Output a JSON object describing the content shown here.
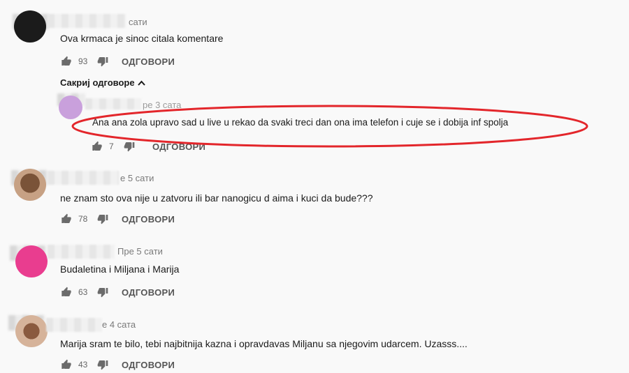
{
  "hide_replies": {
    "label": "Сакриј одговоре",
    "icon": "chevron-up-icon"
  },
  "reply_label": "ОДГОВОРИ",
  "comments": [
    {
      "time": "сати",
      "text": "Ova krmaca je sinoc citala komentare",
      "likes": "93"
    },
    {
      "time": "ре 3 сата",
      "text": "Ana ana zola upravo sad u live u rekao da svaki treci dan ona ima telefon i cuje se i dobija inf spolja",
      "likes": "7",
      "is_reply": true
    },
    {
      "time": "е 5 сати",
      "text": "ne znam sto ova nije u zatvoru ili bar nanogicu d aima i kuci da bude???",
      "likes": "78"
    },
    {
      "time": "Пре 5 сати",
      "text": "Budaletina i Miljana i Marija",
      "likes": "63"
    },
    {
      "time": "е 4 сата",
      "text": "Marija sram te bilo, tebi najbitnija kazna i opravdavas Miljanu sa njegovim udarcem. Uzasss....",
      "likes": "43"
    }
  ],
  "colors": {
    "highlight": "#e3262b",
    "avatar_pink": "#e93d8f",
    "avatar_lilac": "#c9a0dc"
  }
}
